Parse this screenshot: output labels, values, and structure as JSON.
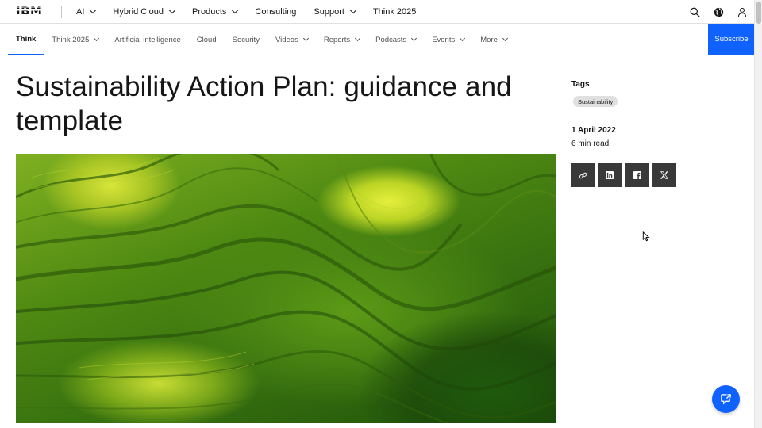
{
  "brand": {
    "logo_text": "IBM"
  },
  "topnav": {
    "items": [
      {
        "label": "AI",
        "has_menu": true
      },
      {
        "label": "Hybrid Cloud",
        "has_menu": true
      },
      {
        "label": "Products",
        "has_menu": true
      },
      {
        "label": "Consulting",
        "has_menu": false
      },
      {
        "label": "Support",
        "has_menu": true
      },
      {
        "label": "Think 2025",
        "has_menu": false
      }
    ],
    "icons": [
      "search-icon",
      "globe-icon",
      "user-icon"
    ]
  },
  "subnav": {
    "items": [
      {
        "label": "Think",
        "active": true,
        "has_menu": false
      },
      {
        "label": "Think 2025",
        "has_menu": true
      },
      {
        "label": "Artificial intelligence",
        "has_menu": false
      },
      {
        "label": "Cloud",
        "has_menu": false
      },
      {
        "label": "Security",
        "has_menu": false
      },
      {
        "label": "Videos",
        "has_menu": true
      },
      {
        "label": "Reports",
        "has_menu": true
      },
      {
        "label": "Podcasts",
        "has_menu": true
      },
      {
        "label": "Events",
        "has_menu": true
      },
      {
        "label": "More",
        "has_menu": true
      }
    ],
    "subscribe_label": "Subscribe"
  },
  "article": {
    "title": "Sustainability Action Plan: guidance and template",
    "hero_image": "aerial-rice-terraces"
  },
  "sidebar": {
    "tags_label": "Tags",
    "tags": [
      "Sustainability"
    ],
    "date": "1 April 2022",
    "read_time": "6 min read",
    "share_icons": [
      "link-icon",
      "linkedin-icon",
      "facebook-icon",
      "x-icon"
    ]
  },
  "colors": {
    "accent": "#0f62fe",
    "share_bg": "#393939",
    "text": "#161616",
    "tag_bg": "#e0e0e0"
  }
}
